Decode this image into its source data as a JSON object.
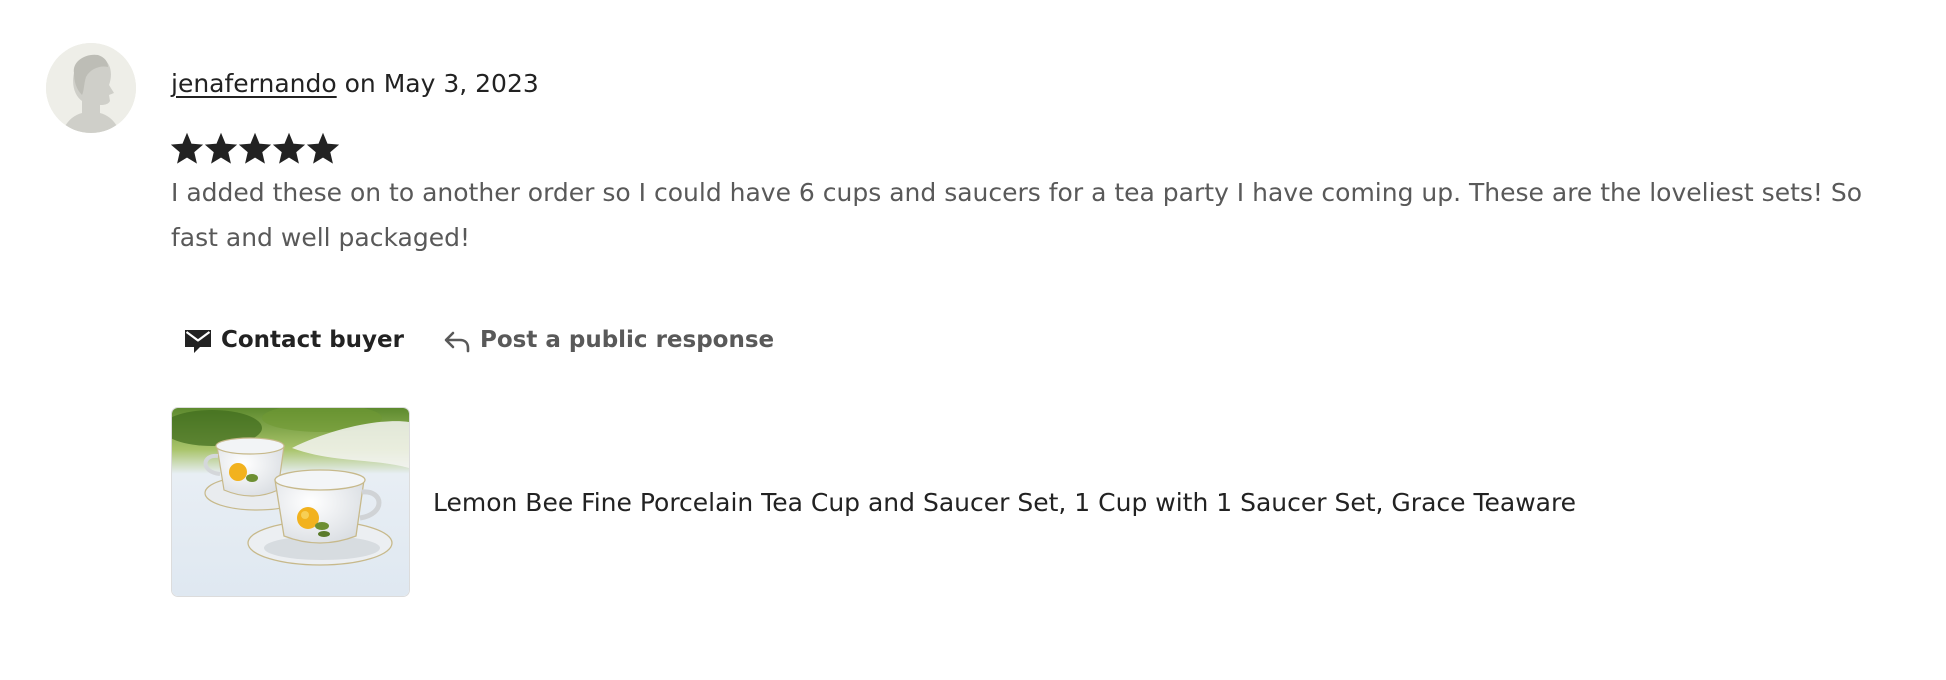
{
  "review": {
    "username": "jenafernando",
    "date_text": " on May 3, 2023",
    "rating": 5,
    "rating_max": 5,
    "text": "I added these on to another order so I could have 6 cups and saucers for a tea party I have coming up. These are the loveliest sets! So fast and well packaged!"
  },
  "actions": {
    "contact_label": "Contact buyer",
    "contact_icon": "envelope-icon",
    "respond_label": "Post a public response",
    "respond_icon": "reply-arrow-icon"
  },
  "product": {
    "title": "Lemon Bee Fine Porcelain Tea Cup and Saucer Set, 1 Cup with 1 Saucer Set, Grace Teaware"
  },
  "colors": {
    "text_primary": "#222222",
    "text_secondary": "#595959",
    "star": "#222222",
    "avatar_bg": "#eeeee8"
  }
}
